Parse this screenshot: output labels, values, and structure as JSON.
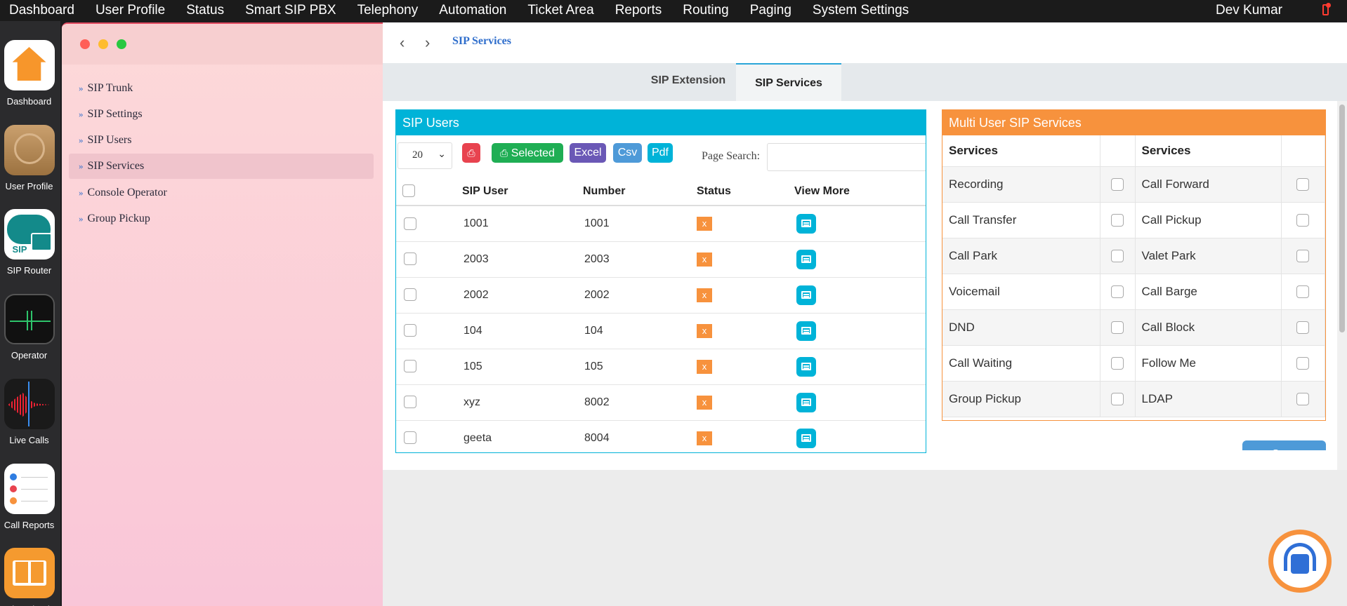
{
  "menubar": {
    "items": [
      "Dashboard",
      "User Profile",
      "Status",
      "Smart SIP PBX",
      "Telephony",
      "Automation",
      "Ticket Area",
      "Reports",
      "Routing",
      "Paging",
      "System Settings"
    ],
    "user": "Dev Kumar"
  },
  "dock": {
    "items": [
      {
        "label": "Dashboard",
        "icon": "home-icon"
      },
      {
        "label": "User Profile",
        "icon": "contacts-icon"
      },
      {
        "label": "SIP Router",
        "icon": "sip-cloud-icon",
        "badge": "SIP"
      },
      {
        "label": "Operator",
        "icon": "activity-monitor-icon"
      },
      {
        "label": "Live Calls",
        "icon": "voice-memo-icon"
      },
      {
        "label": "Call Reports",
        "icon": "reminders-icon"
      },
      {
        "label": "Phonebook",
        "icon": "book-icon"
      }
    ]
  },
  "sidebar": {
    "items": [
      "SIP Trunk",
      "SIP Settings",
      "SIP Users",
      "SIP Services",
      "Console Operator",
      "Group Pickup"
    ],
    "active": "SIP Services"
  },
  "header": {
    "breadcrumb": "SIP Services"
  },
  "tabs": [
    {
      "label": "SIP Extension",
      "active": false
    },
    {
      "label": "SIP Services",
      "active": true
    }
  ],
  "sip_users": {
    "title": "SIP Users",
    "page_size": "20",
    "buttons": {
      "selected": "Selected",
      "excel": "Excel",
      "csv": "Csv",
      "pdf": "Pdf"
    },
    "search_label": "Page Search:",
    "columns": [
      "SIP User",
      "Number",
      "Status",
      "View More"
    ],
    "rows": [
      {
        "user": "1001",
        "number": "1001",
        "status": "x"
      },
      {
        "user": "2003",
        "number": "2003",
        "status": "x"
      },
      {
        "user": "2002",
        "number": "2002",
        "status": "x"
      },
      {
        "user": "104",
        "number": "104",
        "status": "x"
      },
      {
        "user": "105",
        "number": "105",
        "status": "x"
      },
      {
        "user": "xyz",
        "number": "8002",
        "status": "x"
      },
      {
        "user": "geeta",
        "number": "8004",
        "status": "x"
      }
    ]
  },
  "multi": {
    "title": "Multi User SIP Services",
    "header_left": "Services",
    "header_right": "Services",
    "rows": [
      [
        "Recording",
        "Call Forward"
      ],
      [
        "Call Transfer",
        "Call Pickup"
      ],
      [
        "Call Park",
        "Valet Park"
      ],
      [
        "Voicemail",
        "Call Barge"
      ],
      [
        "DND",
        "Call Block"
      ],
      [
        "Call Waiting",
        "Follow Me"
      ],
      [
        "Group Pickup",
        "LDAP"
      ]
    ],
    "save": "Save"
  },
  "colors": {
    "accent_blue": "#00b3d8",
    "accent_orange": "#f7923d",
    "link_blue": "#2f6ecc",
    "print_red": "#e8434f",
    "selected_green": "#1fae54",
    "excel_purple": "#6a58b6",
    "csv_blue": "#4e9ad8"
  }
}
